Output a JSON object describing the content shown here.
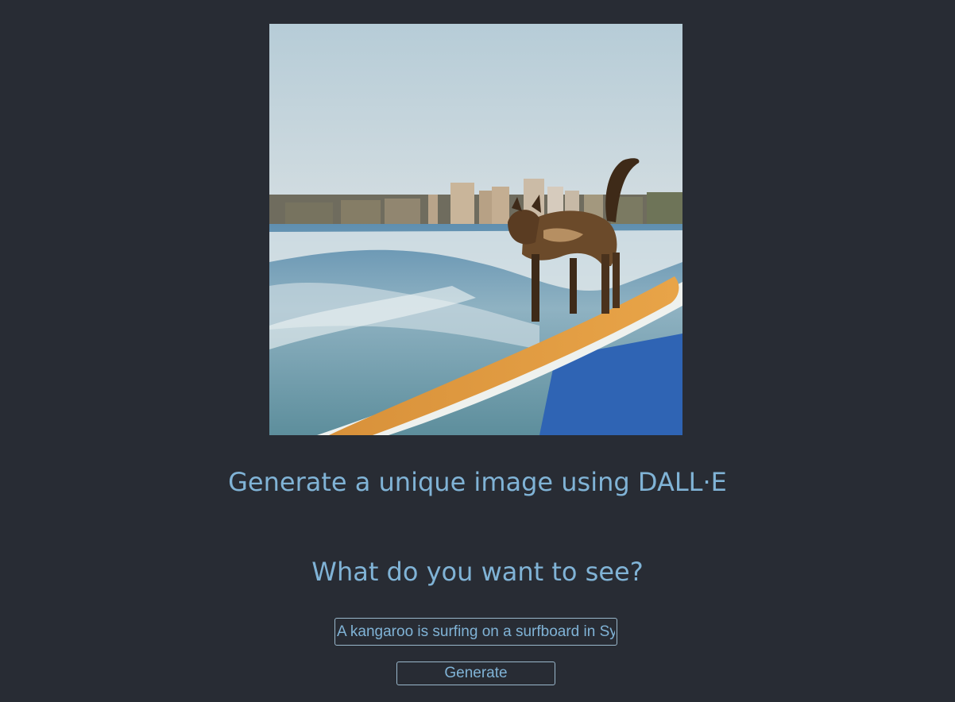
{
  "page": {
    "background_color": "#282c34",
    "accent_color": "#80b3d6"
  },
  "generated_image": {
    "icon": "generated-image"
  },
  "headings": {
    "generate": "Generate a unique image using DALL·E",
    "question": "What do you want to see?"
  },
  "prompt": {
    "value": "A kangaroo is surfing on a surfboard in Sydney"
  },
  "actions": {
    "generate_label": "Generate"
  }
}
